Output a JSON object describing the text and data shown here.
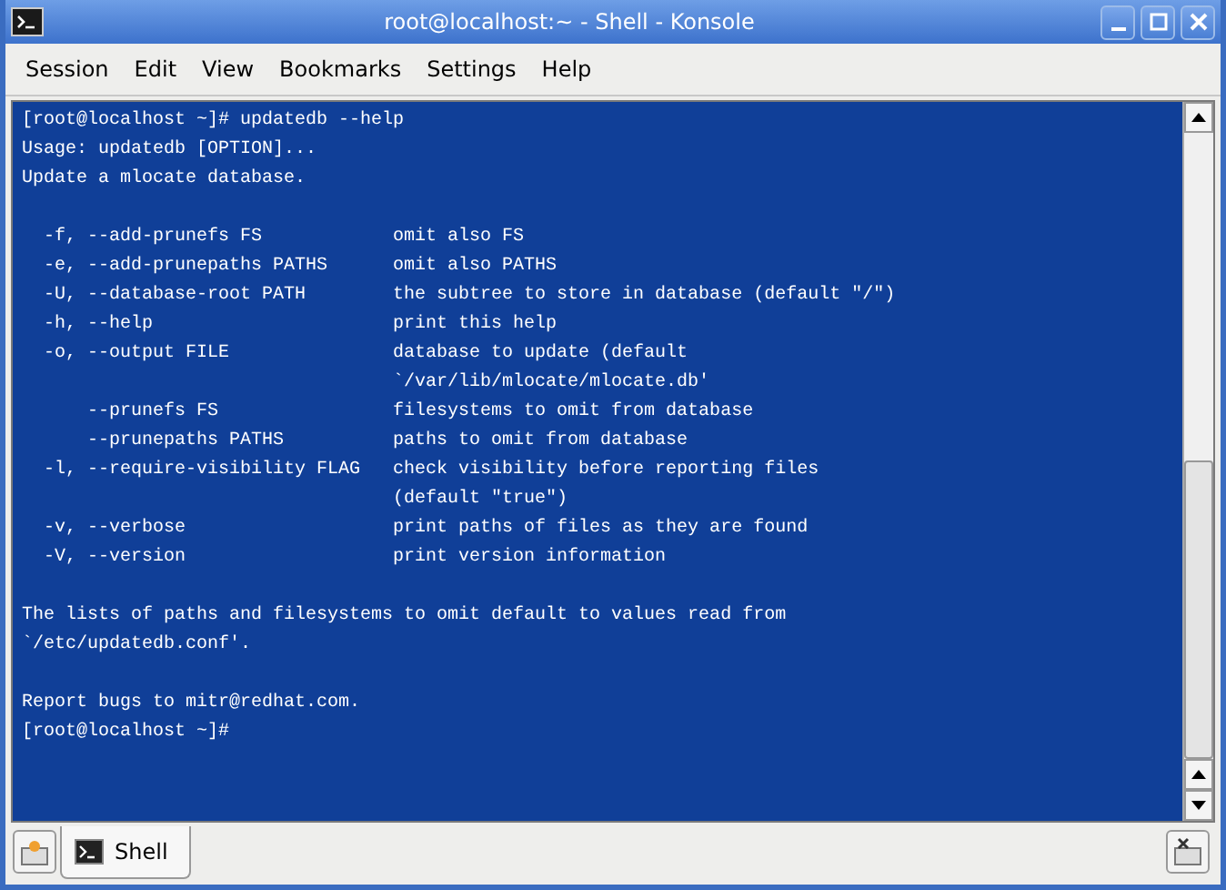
{
  "window": {
    "title": "root@localhost:~ - Shell - Konsole"
  },
  "menu": [
    "Session",
    "Edit",
    "View",
    "Bookmarks",
    "Settings",
    "Help"
  ],
  "terminal": {
    "blocks": [
      {
        "lines": [
          "[root@localhost ~]# updatedb --help",
          "Usage: updatedb [OPTION]...",
          "Update a mlocate database."
        ]
      },
      {
        "lines": [
          "  -f, --add-prunefs FS            omit also FS",
          "  -e, --add-prunepaths PATHS      omit also PATHS",
          "  -U, --database-root PATH        the subtree to store in database (default \"/\")",
          "  -h, --help                      print this help",
          "  -o, --output FILE               database to update (default",
          "                                  `/var/lib/mlocate/mlocate.db'",
          "      --prunefs FS                filesystems to omit from database",
          "      --prunepaths PATHS          paths to omit from database",
          "  -l, --require-visibility FLAG   check visibility before reporting files",
          "                                  (default \"true\")",
          "  -v, --verbose                   print paths of files as they are found",
          "  -V, --version                   print version information"
        ]
      },
      {
        "lines": [
          "The lists of paths and filesystems to omit default to values read from",
          "`/etc/updatedb.conf'."
        ]
      },
      {
        "lines": [
          "Report bugs to mitr@redhat.com.",
          "[root@localhost ~]#"
        ]
      }
    ]
  },
  "tabs": [
    {
      "label": "Shell",
      "selected": true
    }
  ]
}
